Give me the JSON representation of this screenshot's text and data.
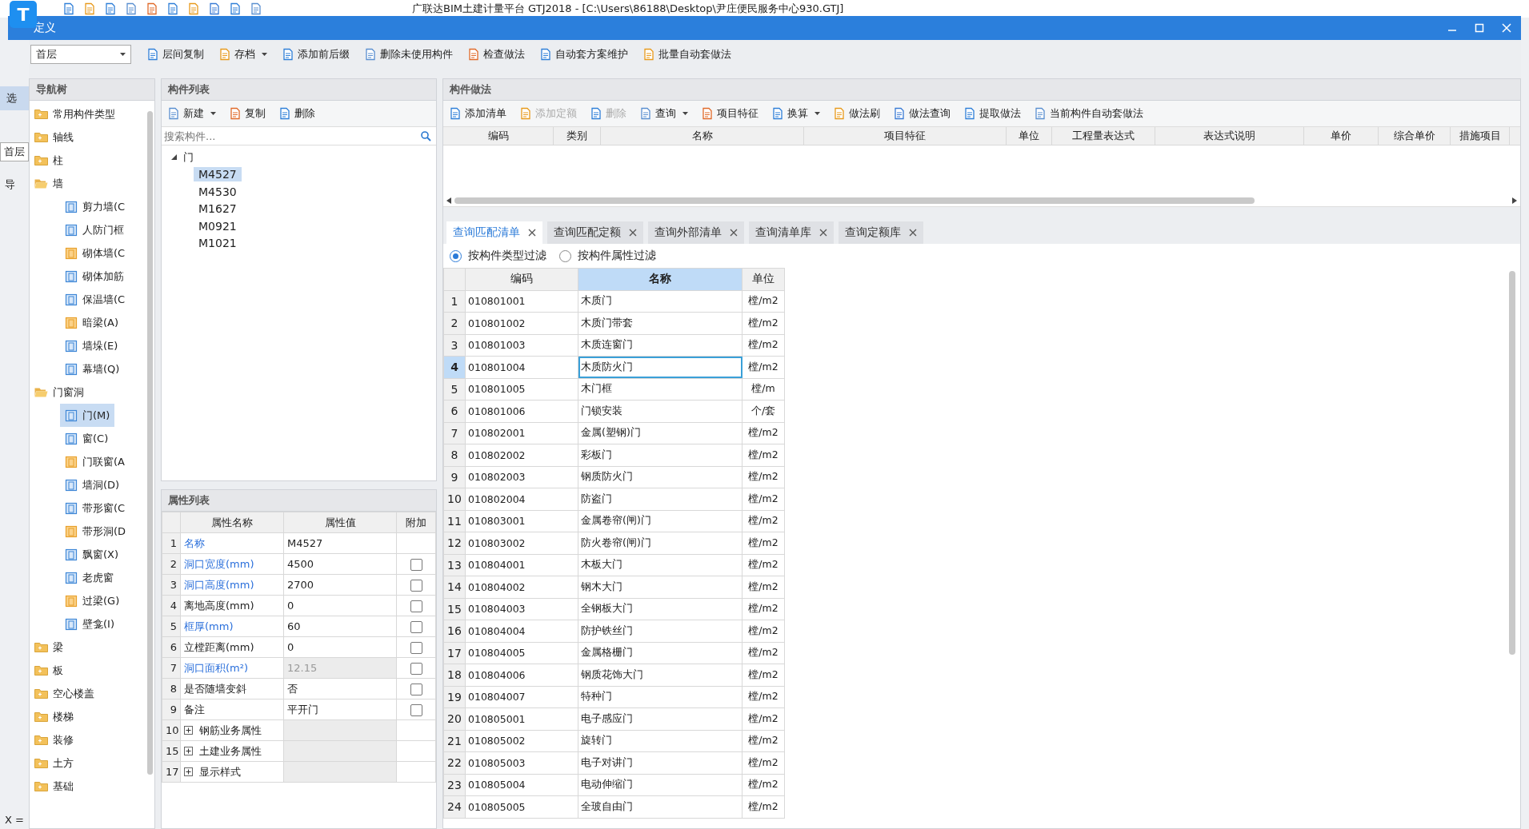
{
  "app": {
    "logo": "T",
    "title": "广联达BIM土建计量平台 GTJ2018 - [C:\\Users\\86188\\Desktop\\尹庄便民服务中心930.GTJ]",
    "side_labels": [
      "选",
      "首层",
      "导",
      "X ="
    ]
  },
  "dialog": {
    "title": "定义"
  },
  "toolbar": {
    "floor": "首层",
    "buttons": [
      {
        "label": "层间复制",
        "dropdown": false
      },
      {
        "label": "存档",
        "dropdown": true
      },
      {
        "label": "添加前后缀",
        "dropdown": false
      },
      {
        "label": "删除未使用构件",
        "dropdown": false
      },
      {
        "label": "检查做法",
        "dropdown": false
      },
      {
        "label": "自动套方案维护",
        "dropdown": false
      },
      {
        "label": "批量自动套做法",
        "dropdown": false
      }
    ]
  },
  "nav_tree": {
    "title": "导航树",
    "items": [
      {
        "label": "常用构件类型",
        "expanded": false,
        "selected": false
      },
      {
        "label": "轴线",
        "expanded": false,
        "selected": false
      },
      {
        "label": "柱",
        "expanded": false,
        "selected": false
      },
      {
        "label": "墙",
        "expanded": true,
        "selected": false,
        "children": [
          {
            "label": "剪力墙(C",
            "selected": false
          },
          {
            "label": "人防门框",
            "selected": false
          },
          {
            "label": "砌体墙(C",
            "selected": false
          },
          {
            "label": "砌体加筋",
            "selected": false
          },
          {
            "label": "保温墙(C",
            "selected": false
          },
          {
            "label": "暗梁(A)",
            "selected": false
          },
          {
            "label": "墙垛(E)",
            "selected": false
          },
          {
            "label": "幕墙(Q)",
            "selected": false
          }
        ]
      },
      {
        "label": "门窗洞",
        "expanded": true,
        "selected": false,
        "children": [
          {
            "label": "门(M)",
            "selected": true
          },
          {
            "label": "窗(C)",
            "selected": false
          },
          {
            "label": "门联窗(A",
            "selected": false
          },
          {
            "label": "墙洞(D)",
            "selected": false
          },
          {
            "label": "带形窗(C",
            "selected": false
          },
          {
            "label": "带形洞(D",
            "selected": false
          },
          {
            "label": "飘窗(X)",
            "selected": false
          },
          {
            "label": "老虎窗",
            "selected": false
          },
          {
            "label": "过梁(G)",
            "selected": false
          },
          {
            "label": "壁龛(I)",
            "selected": false
          }
        ]
      },
      {
        "label": "梁",
        "expanded": false,
        "selected": false
      },
      {
        "label": "板",
        "expanded": false,
        "selected": false
      },
      {
        "label": "空心楼盖",
        "expanded": false,
        "selected": false
      },
      {
        "label": "楼梯",
        "expanded": false,
        "selected": false
      },
      {
        "label": "装修",
        "expanded": false,
        "selected": false
      },
      {
        "label": "土方",
        "expanded": false,
        "selected": false
      },
      {
        "label": "基础",
        "expanded": false,
        "selected": false
      }
    ]
  },
  "component_list": {
    "title": "构件列表",
    "buttons": [
      {
        "label": "新建",
        "dropdown": true
      },
      {
        "label": "复制",
        "dropdown": false
      },
      {
        "label": "删除",
        "dropdown": false
      }
    ],
    "search_placeholder": "搜索构件...",
    "tree": [
      {
        "label": "门",
        "expanded": true,
        "children": [
          {
            "label": "M4527",
            "selected": true
          },
          {
            "label": "M4530",
            "selected": false
          },
          {
            "label": "M1627",
            "selected": false
          },
          {
            "label": "M0921",
            "selected": false
          },
          {
            "label": "M1021",
            "selected": false
          }
        ]
      }
    ]
  },
  "properties": {
    "title": "属性列表",
    "columns": [
      "属性名称",
      "属性值",
      "附加"
    ],
    "rows": [
      {
        "number": "1",
        "name": "名称",
        "value": "M4527",
        "kind": "field",
        "public": true,
        "readonly": false
      },
      {
        "number": "2",
        "name": "洞口宽度(mm)",
        "value": "4500",
        "kind": "option",
        "public": true,
        "readonly": false,
        "checked": false
      },
      {
        "number": "3",
        "name": "洞口高度(mm)",
        "value": "2700",
        "kind": "option",
        "public": true,
        "readonly": false,
        "checked": false
      },
      {
        "number": "4",
        "name": "离地高度(mm)",
        "value": "0",
        "kind": "option",
        "public": false,
        "readonly": false,
        "checked": false
      },
      {
        "number": "5",
        "name": "框厚(mm)",
        "value": "60",
        "kind": "option",
        "public": true,
        "readonly": false,
        "checked": false
      },
      {
        "number": "6",
        "name": "立樘距离(mm)",
        "value": "0",
        "kind": "option",
        "public": false,
        "readonly": false,
        "checked": false
      },
      {
        "number": "7",
        "name": "洞口面积(m²)",
        "value": "12.15",
        "kind": "option",
        "public": true,
        "readonly": true,
        "checked": false
      },
      {
        "number": "8",
        "name": "是否随墙变斜",
        "value": "否",
        "kind": "option",
        "public": false,
        "readonly": false,
        "checked": false
      },
      {
        "number": "9",
        "name": "备注",
        "value": "平开门",
        "kind": "option",
        "public": false,
        "readonly": false,
        "checked": false
      },
      {
        "number": "10",
        "name": "钢筋业务属性",
        "kind": "group",
        "expanded": false
      },
      {
        "number": "15",
        "name": "土建业务属性",
        "kind": "group",
        "expanded": false
      },
      {
        "number": "17",
        "name": "显示样式",
        "kind": "group",
        "expanded": false
      }
    ]
  },
  "methods": {
    "title": "构件做法",
    "toolbar": [
      {
        "label": "添加清单",
        "disabled": false,
        "dropdown": false
      },
      {
        "label": "添加定额",
        "disabled": true,
        "dropdown": false
      },
      {
        "label": "删除",
        "disabled": true,
        "dropdown": false
      },
      {
        "label": "查询",
        "disabled": false,
        "dropdown": true
      },
      {
        "label": "项目特征",
        "disabled": false,
        "dropdown": false
      },
      {
        "label": "换算",
        "disabled": false,
        "dropdown": true
      },
      {
        "label": "做法刷",
        "disabled": false,
        "dropdown": false
      },
      {
        "label": "做法查询",
        "disabled": false,
        "dropdown": false
      },
      {
        "label": "提取做法",
        "disabled": false,
        "dropdown": false
      },
      {
        "label": "当前构件自动套做法",
        "disabled": false,
        "dropdown": false
      }
    ],
    "columns": [
      "编码",
      "类别",
      "名称",
      "项目特征",
      "单位",
      "工程量表达式",
      "表达式说明",
      "单价",
      "综合单价",
      "措施项目"
    ]
  },
  "query": {
    "tabs": [
      {
        "label": "查询匹配清单",
        "selected": true
      },
      {
        "label": "查询匹配定额",
        "selected": false
      },
      {
        "label": "查询外部清单",
        "selected": false
      },
      {
        "label": "查询清单库",
        "selected": false
      },
      {
        "label": "查询定额库",
        "selected": false
      }
    ],
    "filters": [
      {
        "label": "按构件类型过滤",
        "selected": true
      },
      {
        "label": "按构件属性过滤",
        "selected": false
      }
    ],
    "columns": [
      {
        "label": "编码",
        "selected": false
      },
      {
        "label": "名称",
        "selected": true
      },
      {
        "label": "单位",
        "selected": false
      }
    ],
    "rows": [
      {
        "number": "1",
        "code": "010801001",
        "name": "木质门",
        "unit": "樘/m2",
        "selected": false
      },
      {
        "number": "2",
        "code": "010801002",
        "name": "木质门带套",
        "unit": "樘/m2",
        "selected": false
      },
      {
        "number": "3",
        "code": "010801003",
        "name": "木质连窗门",
        "unit": "樘/m2",
        "selected": false
      },
      {
        "number": "4",
        "code": "010801004",
        "name": "木质防火门",
        "unit": "樘/m2",
        "selected": true
      },
      {
        "number": "5",
        "code": "010801005",
        "name": "木门框",
        "unit": "樘/m",
        "selected": false
      },
      {
        "number": "6",
        "code": "010801006",
        "name": "门锁安装",
        "unit": "个/套",
        "selected": false
      },
      {
        "number": "7",
        "code": "010802001",
        "name": "金属(塑钢)门",
        "unit": "樘/m2",
        "selected": false
      },
      {
        "number": "8",
        "code": "010802002",
        "name": "彩板门",
        "unit": "樘/m2",
        "selected": false
      },
      {
        "number": "9",
        "code": "010802003",
        "name": "钢质防火门",
        "unit": "樘/m2",
        "selected": false
      },
      {
        "number": "10",
        "code": "010802004",
        "name": "防盗门",
        "unit": "樘/m2",
        "selected": false
      },
      {
        "number": "11",
        "code": "010803001",
        "name": "金属卷帘(闸)门",
        "unit": "樘/m2",
        "selected": false
      },
      {
        "number": "12",
        "code": "010803002",
        "name": "防火卷帘(闸)门",
        "unit": "樘/m2",
        "selected": false
      },
      {
        "number": "13",
        "code": "010804001",
        "name": "木板大门",
        "unit": "樘/m2",
        "selected": false
      },
      {
        "number": "14",
        "code": "010804002",
        "name": "钢木大门",
        "unit": "樘/m2",
        "selected": false
      },
      {
        "number": "15",
        "code": "010804003",
        "name": "全钢板大门",
        "unit": "樘/m2",
        "selected": false
      },
      {
        "number": "16",
        "code": "010804004",
        "name": "防护铁丝门",
        "unit": "樘/m2",
        "selected": false
      },
      {
        "number": "17",
        "code": "010804005",
        "name": "金属格栅门",
        "unit": "樘/m2",
        "selected": false
      },
      {
        "number": "18",
        "code": "010804006",
        "name": "钢质花饰大门",
        "unit": "樘/m2",
        "selected": false
      },
      {
        "number": "19",
        "code": "010804007",
        "name": "特种门",
        "unit": "樘/m2",
        "selected": false
      },
      {
        "number": "20",
        "code": "010805001",
        "name": "电子感应门",
        "unit": "樘/m2",
        "selected": false
      },
      {
        "number": "21",
        "code": "010805002",
        "name": "旋转门",
        "unit": "樘/m2",
        "selected": false
      },
      {
        "number": "22",
        "code": "010805003",
        "name": "电子对讲门",
        "unit": "樘/m2",
        "selected": false
      },
      {
        "number": "23",
        "code": "010805004",
        "name": "电动伸缩门",
        "unit": "樘/m2",
        "selected": false
      },
      {
        "number": "24",
        "code": "010805005",
        "name": "全玻自由门",
        "unit": "樘/m2",
        "selected": false
      }
    ]
  }
}
